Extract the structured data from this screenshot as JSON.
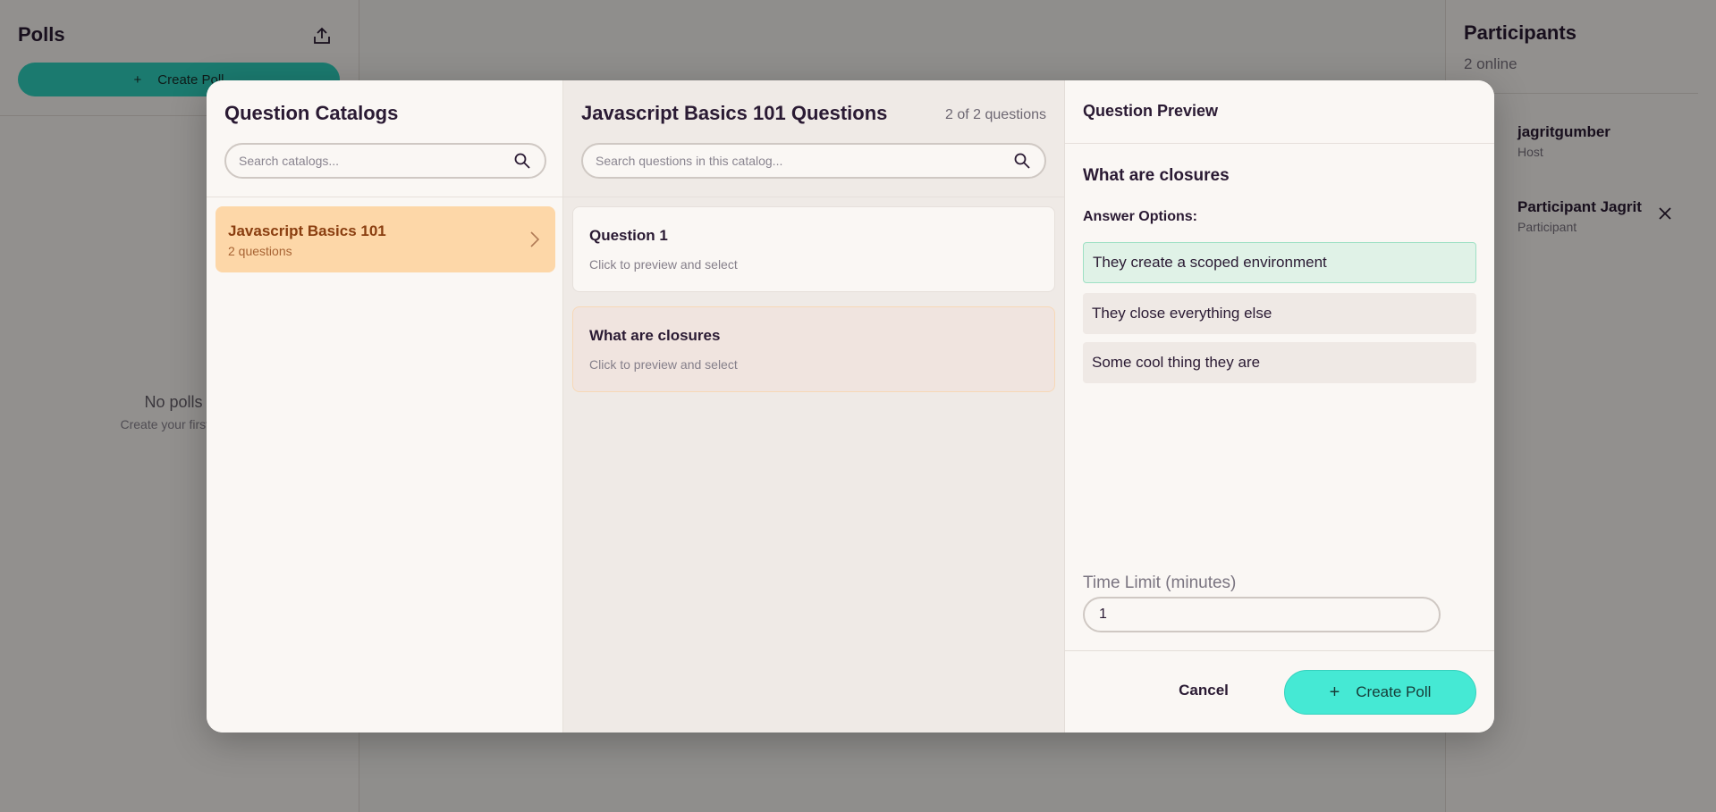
{
  "background": {
    "polls": {
      "title": "Polls",
      "create_label": "Create Poll",
      "empty_title": "No polls y",
      "empty_sub": "Create your first poll t"
    },
    "participants": {
      "title": "Participants",
      "online": "2 online",
      "list": [
        {
          "name": "jagritgumber",
          "role": "Host"
        },
        {
          "name": "Participant Jagrit",
          "role": "Participant"
        }
      ]
    }
  },
  "modal": {
    "catalogs": {
      "title": "Question Catalogs",
      "search_placeholder": "Search catalogs...",
      "items": [
        {
          "name": "Javascript Basics 101",
          "count": "2 questions"
        }
      ]
    },
    "questions": {
      "title": "Javascript Basics 101 Questions",
      "count": "2 of 2 questions",
      "search_placeholder": "Search questions in this catalog...",
      "items": [
        {
          "title": "Question 1",
          "hint": "Click to preview and select"
        },
        {
          "title": "What are closures",
          "hint": "Click to preview and select"
        }
      ]
    },
    "preview": {
      "title": "Question Preview",
      "question": "What are closures",
      "answers_label": "Answer Options:",
      "answers": [
        "They create a scoped environment",
        "They close everything else",
        "Some cool thing they are"
      ],
      "time_label": "Time Limit (minutes)",
      "time_value": "1",
      "cancel_label": "Cancel",
      "create_label": "Create Poll"
    }
  },
  "colors": {
    "accent": "#45e9d4",
    "catalog_selected": "#fdd7a8",
    "correct_answer": "#e0f2e7"
  }
}
